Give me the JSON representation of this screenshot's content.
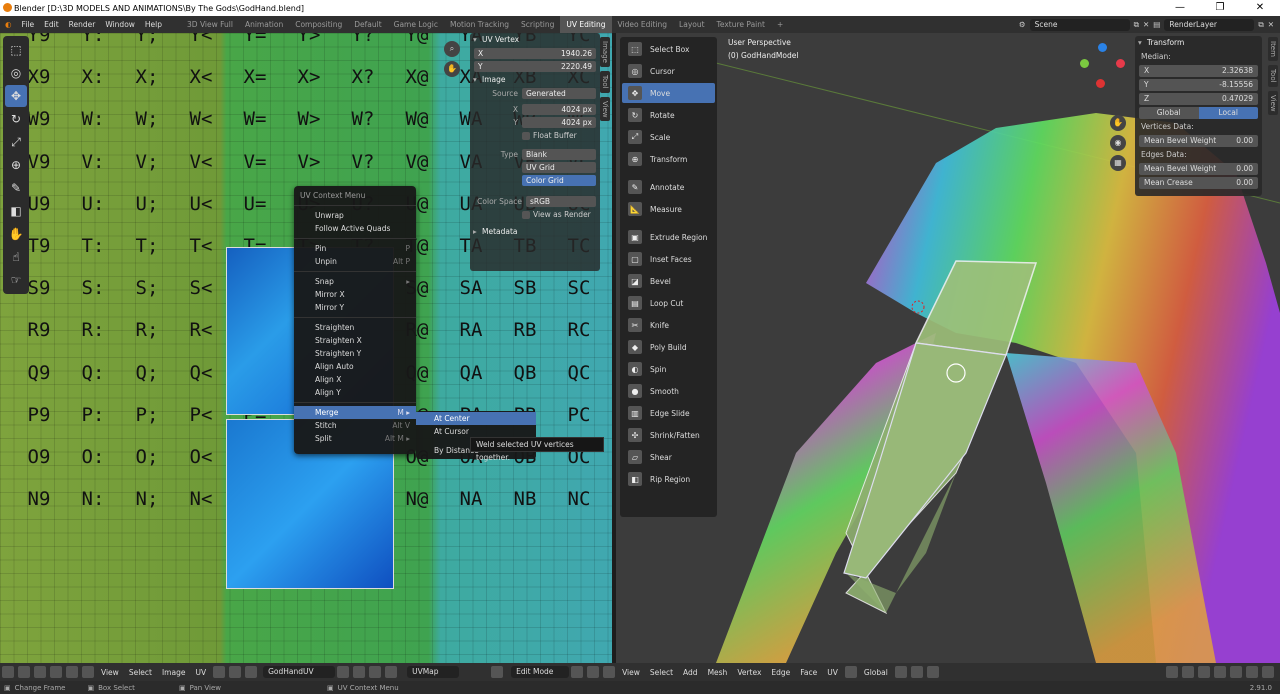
{
  "window": {
    "title": "Blender [D:\\3D MODELS AND ANIMATIONS\\By The Gods\\GodHand.blend]"
  },
  "menu": [
    "File",
    "Edit",
    "Render",
    "Window",
    "Help"
  ],
  "workspaces": [
    "3D View Full",
    "Animation",
    "Compositing",
    "Default",
    "Game Logic",
    "Motion Tracking",
    "Scripting",
    "UV Editing",
    "Video Editing",
    "Layout",
    "Texture Paint"
  ],
  "active_workspace": "UV Editing",
  "scene": {
    "name": "Scene",
    "render_layer": "RenderLayer"
  },
  "uv_grid": {
    "rows": [
      "Y",
      "X",
      "W",
      "V",
      "U",
      "T",
      "S",
      "R",
      "Q",
      "P",
      "O",
      "N"
    ],
    "cols": [
      [
        "Y9",
        "Y:",
        "Y;",
        "Y<",
        "Y=",
        "Y>",
        "Y?",
        "Y@",
        "YA",
        "YB",
        "YC"
      ],
      [
        "X9",
        "X:",
        "X;",
        "X<",
        "X=",
        "X>",
        "X?",
        "X@",
        "XA",
        "XB",
        "XC"
      ],
      [
        "W9",
        "W:",
        "W;",
        "W<",
        "W=",
        "W>",
        "W?",
        "W@",
        "WA",
        "WB",
        "WC"
      ],
      [
        "V9",
        "V:",
        "V;",
        "V<",
        "V=",
        "V>",
        "V?",
        "V@",
        "VA",
        "VB",
        "VC"
      ],
      [
        "U9",
        "U:",
        "U;",
        "U<",
        "U=",
        "U>",
        "U?",
        "U@",
        "UA",
        "UB",
        "UC"
      ],
      [
        "T9",
        "T:",
        "T;",
        "T<",
        "T=",
        "T>",
        "T?",
        "T@",
        "TA",
        "TB",
        "TC"
      ],
      [
        "S9",
        "S:",
        "S;",
        "S<",
        "S=",
        "S>",
        "S?",
        "S@",
        "SA",
        "SB",
        "SC"
      ],
      [
        "R9",
        "R:",
        "R;",
        "R<",
        "R=",
        "R>",
        "R?",
        "R@",
        "RA",
        "RB",
        "RC"
      ],
      [
        "Q9",
        "Q:",
        "Q;",
        "Q<",
        "Q=",
        "Q>",
        "Q?",
        "Q@",
        "QA",
        "QB",
        "QC"
      ],
      [
        "P9",
        "P:",
        "P;",
        "P<",
        "P=",
        "P>",
        "P?",
        "P@",
        "PA",
        "PB",
        "PC"
      ],
      [
        "O9",
        "O:",
        "O;",
        "O<",
        "O=",
        "O>",
        "O?",
        "O@",
        "OA",
        "OB",
        "OC"
      ],
      [
        "N9",
        "N:",
        "N;",
        "N<",
        "N=",
        "N>",
        "N?",
        "N@",
        "NA",
        "NB",
        "NC"
      ]
    ]
  },
  "uv_panel": {
    "uv_vertex_header": "UV Vertex",
    "x_label": "X",
    "x_value": "1940.26",
    "y_label": "Y",
    "y_value": "2220.49",
    "image_header": "Image",
    "source_label": "Source",
    "source_value": "Generated",
    "width_label": "X",
    "width_value": "4024 px",
    "height_label": "Y",
    "height_value": "4024 px",
    "float_buffer": "Float Buffer",
    "type_label": "Type",
    "type_options": [
      "Blank",
      "UV Grid",
      "Color Grid"
    ],
    "color_space_label": "Color Space",
    "color_space_value": "sRGB",
    "view_as_render": "View as Render",
    "metadata_header": "Metadata"
  },
  "uv_sidetabs": [
    "Image",
    "Tool",
    "View"
  ],
  "context_menu": {
    "title": "UV Context Menu",
    "items": [
      {
        "label": "Unwrap",
        "shortcut": ""
      },
      {
        "label": "Follow Active Quads",
        "shortcut": ""
      },
      {
        "label": "Pin",
        "shortcut": "P"
      },
      {
        "label": "Unpin",
        "shortcut": "Alt P"
      },
      {
        "label": "Snap",
        "shortcut": "▸"
      },
      {
        "label": "Mirror X",
        "shortcut": ""
      },
      {
        "label": "Mirror Y",
        "shortcut": ""
      },
      {
        "label": "Straighten",
        "shortcut": ""
      },
      {
        "label": "Straighten X",
        "shortcut": ""
      },
      {
        "label": "Straighten Y",
        "shortcut": ""
      },
      {
        "label": "Align Auto",
        "shortcut": ""
      },
      {
        "label": "Align X",
        "shortcut": ""
      },
      {
        "label": "Align Y",
        "shortcut": ""
      },
      {
        "label": "Merge",
        "shortcut": "M ▸"
      },
      {
        "label": "Stitch",
        "shortcut": "Alt V"
      },
      {
        "label": "Split",
        "shortcut": "Alt M ▸"
      }
    ]
  },
  "merge_submenu": [
    "At Center",
    "At Cursor",
    "By Distance"
  ],
  "tooltip": "Weld selected UV vertices together.",
  "viewport": {
    "perspective": "User Perspective",
    "object": "(0) GodHandModel"
  },
  "tool_menu": [
    {
      "label": "Select Box",
      "icon": "select-box-icon",
      "glyph": "⬚"
    },
    {
      "label": "Cursor",
      "icon": "cursor-icon",
      "glyph": "◎"
    },
    {
      "label": "Move",
      "icon": "move-icon",
      "glyph": "✥"
    },
    {
      "label": "Rotate",
      "icon": "rotate-icon",
      "glyph": "↻"
    },
    {
      "label": "Scale",
      "icon": "scale-icon",
      "glyph": "⤢"
    },
    {
      "label": "Transform",
      "icon": "transform-icon",
      "glyph": "⊕"
    },
    {
      "label": "Annotate",
      "icon": "annotate-icon",
      "glyph": "✎"
    },
    {
      "label": "Measure",
      "icon": "measure-icon",
      "glyph": "📐"
    },
    {
      "label": "Extrude Region",
      "icon": "extrude-icon",
      "glyph": "▣"
    },
    {
      "label": "Inset Faces",
      "icon": "inset-icon",
      "glyph": "▢"
    },
    {
      "label": "Bevel",
      "icon": "bevel-icon",
      "glyph": "◪"
    },
    {
      "label": "Loop Cut",
      "icon": "loop-cut-icon",
      "glyph": "▤"
    },
    {
      "label": "Knife",
      "icon": "knife-icon",
      "glyph": "✂"
    },
    {
      "label": "Poly Build",
      "icon": "poly-build-icon",
      "glyph": "◆"
    },
    {
      "label": "Spin",
      "icon": "spin-icon",
      "glyph": "◐"
    },
    {
      "label": "Smooth",
      "icon": "smooth-icon",
      "glyph": "●"
    },
    {
      "label": "Edge Slide",
      "icon": "edge-slide-icon",
      "glyph": "▥"
    },
    {
      "label": "Shrink/Fatten",
      "icon": "shrink-icon",
      "glyph": "✣"
    },
    {
      "label": "Shear",
      "icon": "shear-icon",
      "glyph": "▱"
    },
    {
      "label": "Rip Region",
      "icon": "rip-icon",
      "glyph": "◧"
    }
  ],
  "transform": {
    "header": "Transform",
    "median_label": "Median:",
    "x": {
      "label": "X",
      "value": "2.32638"
    },
    "y": {
      "label": "Y",
      "value": "-8.15556"
    },
    "z": {
      "label": "Z",
      "value": "0.47029"
    },
    "global_label": "Global",
    "local_label": "Local",
    "vertices_data_label": "Vertices Data:",
    "mean_bevel_weight_v": {
      "label": "Mean Bevel Weight",
      "value": "0.00"
    },
    "edges_data_label": "Edges Data:",
    "mean_bevel_weight_e": {
      "label": "Mean Bevel Weight",
      "value": "0.00"
    },
    "mean_crease": {
      "label": "Mean Crease",
      "value": "0.00"
    }
  },
  "view3d_sidetabs": [
    "Item",
    "Tool",
    "View"
  ],
  "uv_header": {
    "menus": [
      "View",
      "Select",
      "Image",
      "UV"
    ],
    "image_name": "GodHandUV",
    "uvmap": "UVMap"
  },
  "view3d_header": {
    "mode": "Edit Mode",
    "menus": [
      "View",
      "Select",
      "Add",
      "Mesh",
      "Vertex",
      "Edge",
      "Face",
      "UV"
    ],
    "orientation": "Global"
  },
  "status": {
    "items": [
      "Change Frame",
      "Box Select",
      "Pan View",
      "UV Context Menu"
    ],
    "version": "2.91.0"
  },
  "colors": {
    "accent": "#4772b3",
    "bg": "#303030"
  }
}
